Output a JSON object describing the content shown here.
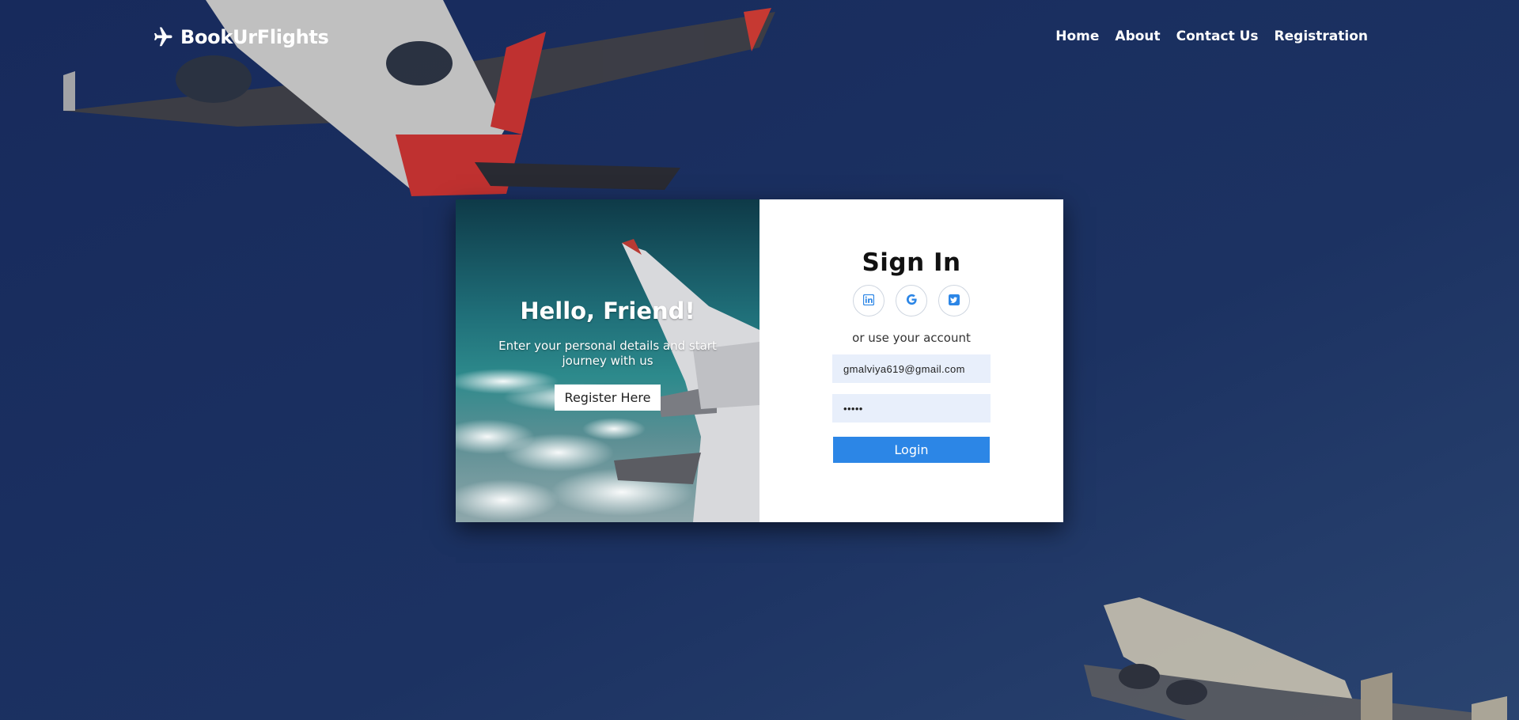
{
  "brand": {
    "name": "BookUrFlights",
    "logo_icon": "plane-icon"
  },
  "nav": {
    "items": [
      "Home",
      "About",
      "Contact Us",
      "Registration"
    ]
  },
  "welcome_panel": {
    "title": "Hello, Friend!",
    "subtitle": "Enter your personal details and start journey with us",
    "register_label": "Register Here"
  },
  "signin": {
    "title": "Sign In",
    "social": [
      "linkedin-icon",
      "google-icon",
      "twitter-icon"
    ],
    "alt_text": "or use your account",
    "email_value": "gmalviya619@gmail.com",
    "password_value": "•••••",
    "login_label": "Login"
  },
  "colors": {
    "background": "#1b3060",
    "login_button": "#2c86e6",
    "input_bg": "#e8effb",
    "social_icon": "#2c86e6"
  }
}
